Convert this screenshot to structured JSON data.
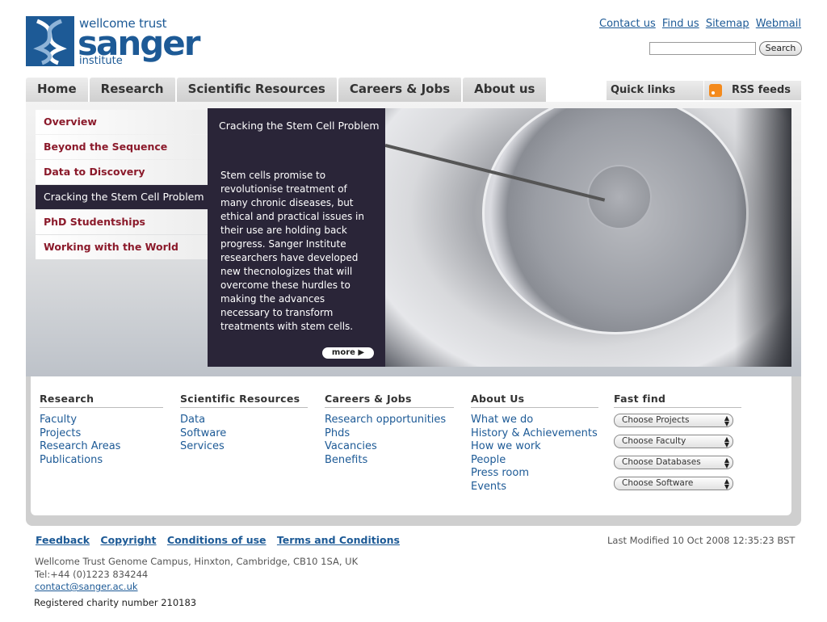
{
  "logo": {
    "line1": "wellcome trust",
    "line2": "sanger",
    "line3": "institute"
  },
  "toplinks": [
    "Contact us",
    "Find us",
    "Sitemap",
    "Webmail"
  ],
  "search": {
    "button": "Search",
    "placeholder": ""
  },
  "nav": {
    "tabs": [
      "Home",
      "Research",
      "Scientific Resources",
      "Careers & Jobs",
      "About us"
    ],
    "quick_links": "Quick links",
    "rss": "RSS feeds"
  },
  "sidemenu": [
    "Overview",
    "Beyond the Sequence",
    "Data to Discovery",
    "Cracking the Stem Cell Problem",
    "PhD Studentships",
    "Working with the World"
  ],
  "panel": {
    "title": "Cracking the Stem Cell Problem",
    "text": "Stem cells promise to revolutionise treatment of many chronic diseases, but ethical and practical issues in their use are holding back progress. Sanger Institute researchers have developed new thecnologizes that will overcome these hurdles to making the advances necessary to transform treatments with stem cells.",
    "more": "more ▶"
  },
  "columns": {
    "research": {
      "heading": "Research",
      "links": [
        "Faculty",
        "Projects",
        "Research Areas",
        "Publications"
      ]
    },
    "resources": {
      "heading": "Scientific Resources",
      "links": [
        "Data",
        "Software",
        "Services"
      ]
    },
    "careers": {
      "heading": "Careers & Jobs",
      "links": [
        "Research opportunities",
        "Phds",
        "Vacancies",
        "Benefits"
      ]
    },
    "about": {
      "heading": "About Us",
      "links": [
        "What we do",
        "History & Achievements",
        "How we work",
        "People",
        "Press room",
        "Events"
      ]
    },
    "fastfind": {
      "heading": "Fast find",
      "selects": [
        "Choose Projects",
        "Choose Faculty",
        "Choose Databases",
        "Choose Software"
      ]
    }
  },
  "footer": {
    "links": [
      "Feedback",
      "Copyright",
      "Conditions of use",
      "Terms and Conditions"
    ],
    "modified": "Last Modified 10 Oct 2008 12:35:23 BST",
    "address": "Wellcome Trust Genome Campus, Hinxton, Cambridge, CB10 1SA, UK",
    "tel": "Tel:+44 (0)1223 834244",
    "email": "contact@sanger.ac.uk",
    "charity": "Registered charity number 210183"
  },
  "colors": {
    "brand_blue": "#1d5a96",
    "menu_red": "#8b1a2b",
    "panel_dark": "#2a2538"
  },
  "icons": {
    "rss": "rss-feed-icon",
    "dropdown": "updown-arrows-icon",
    "logo": "dna-helix-icon"
  }
}
